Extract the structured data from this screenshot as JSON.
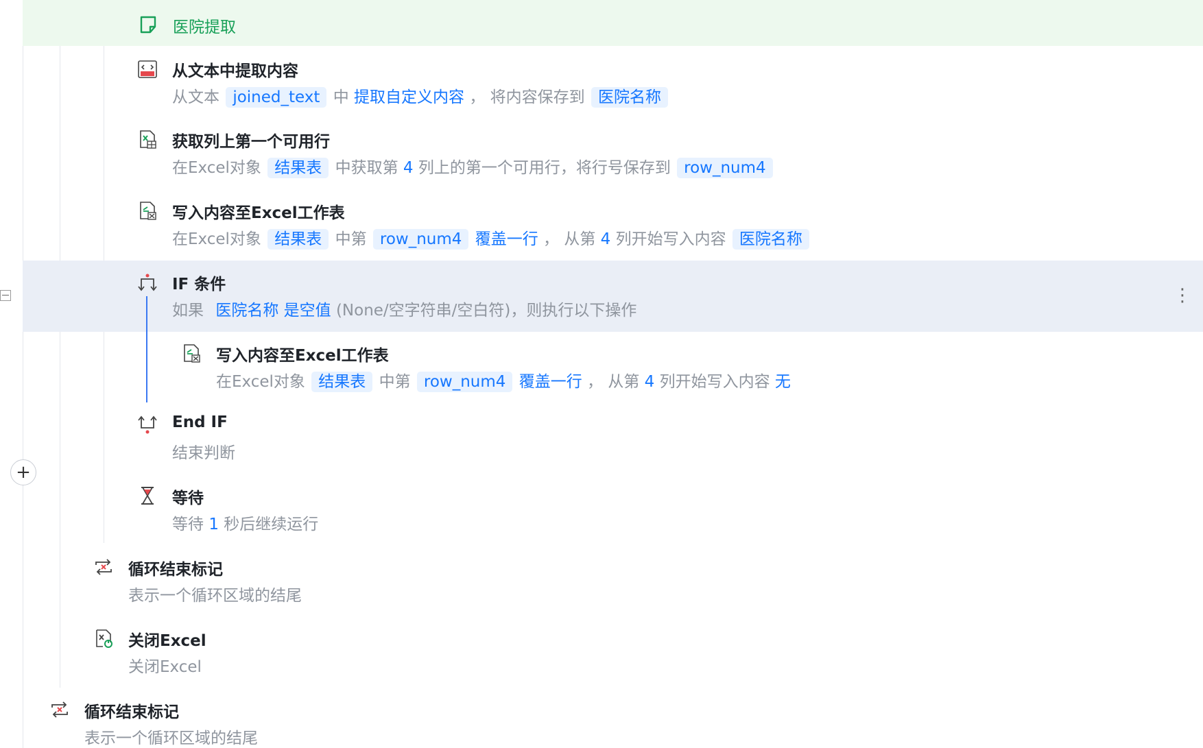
{
  "green_row": {
    "title": "医院提取",
    "icon": "note-icon",
    "color": "#18a058"
  },
  "steps": [
    {
      "title": "从文本中提取内容",
      "icon": "text-extract-icon",
      "parts": [
        "从文本",
        "joined_text",
        "中",
        "提取自定义内容",
        "， 将内容保存到",
        "医院名称"
      ]
    },
    {
      "title": "获取列上第一个可用行",
      "icon": "excel-row-icon",
      "parts": [
        "在Excel对象",
        "结果表",
        "中获取第",
        "4",
        "列上的第一个可用行，将行号保存到",
        "row_num4"
      ]
    },
    {
      "title": "写入内容至Excel工作表",
      "icon": "excel-write-icon",
      "parts": [
        "在Excel对象",
        "结果表",
        "中第",
        "row_num4",
        "覆盖一行",
        "， 从第",
        "4",
        "列开始写入内容",
        "医院名称"
      ]
    },
    {
      "title": "IF 条件",
      "icon": "if-condition-icon",
      "parts": [
        "如果",
        "医院名称",
        "是空值",
        "(None/空字符串/空白符)，则执行以下操作"
      ]
    },
    {
      "title": "写入内容至Excel工作表",
      "icon": "excel-write-icon",
      "parts": [
        "在Excel对象",
        "结果表",
        "中第",
        "row_num4",
        "覆盖一行",
        "， 从第",
        "4",
        "列开始写入内容",
        "无"
      ]
    },
    {
      "title": "End IF",
      "icon": "end-if-icon",
      "parts": [
        "结束判断"
      ]
    },
    {
      "title": "等待",
      "icon": "hourglass-icon",
      "parts": [
        "等待",
        "1",
        "秒后继续运行"
      ]
    },
    {
      "title": "循环结束标记",
      "icon": "loop-end-icon",
      "parts": [
        "表示一个循环区域的结尾"
      ]
    },
    {
      "title": "关闭Excel",
      "icon": "excel-close-icon",
      "parts": [
        "关闭Excel"
      ]
    },
    {
      "title": "循环结束标记",
      "icon": "loop-end-icon",
      "parts": [
        "表示一个循环区域的结尾"
      ]
    }
  ],
  "controls": {
    "more": "⋮",
    "add": "+"
  },
  "colors": {
    "accent": "#1677ff",
    "selected_row": "#eaeef6",
    "green_row_bg": "#edf9ee",
    "red_icon": "#e5484d"
  }
}
